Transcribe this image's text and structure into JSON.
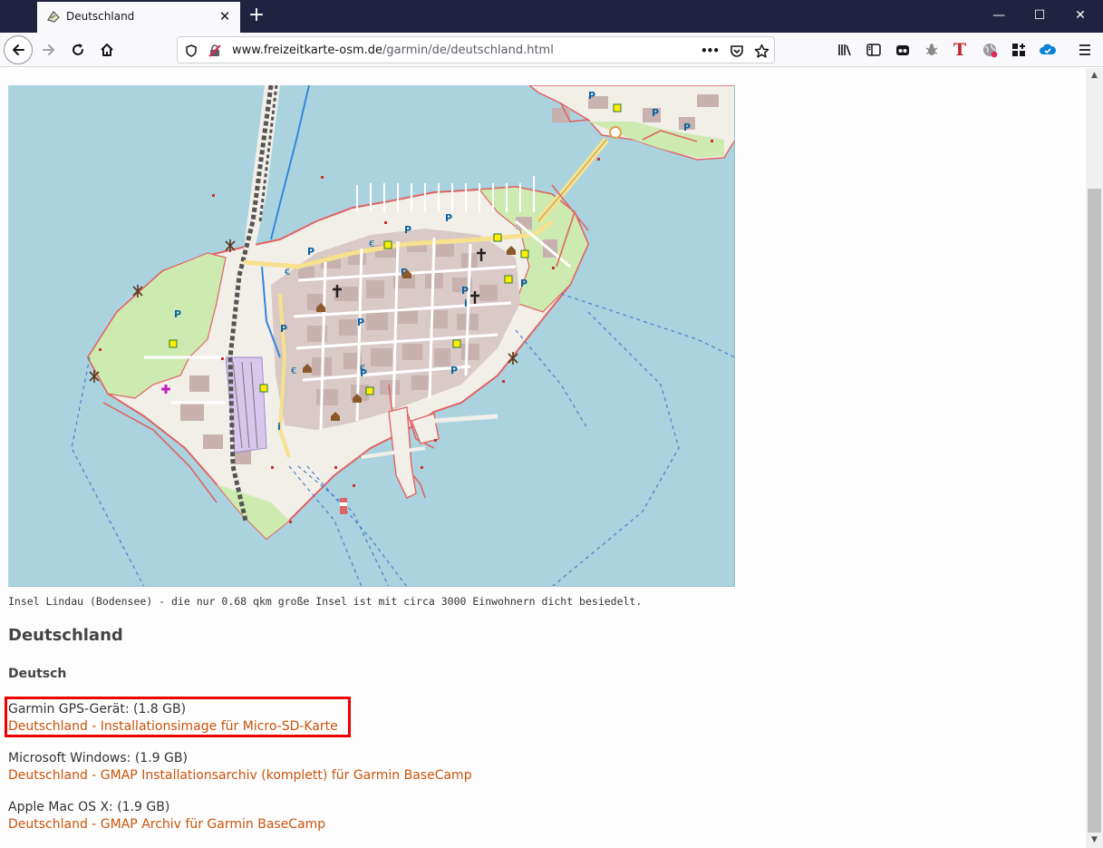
{
  "browser": {
    "tab_title": "Deutschland",
    "url_host": "www.freizeitkarte-osm.de",
    "url_path": "/garmin/de/deutschland.html",
    "page_actions_label": "•••"
  },
  "page": {
    "map_caption": "Insel Lindau (Bodensee) - die nur 0.68 qkm große Insel ist mit circa 3000 Einwohnern dicht besiedelt.",
    "heading": "Deutschland",
    "subheading": "Deutsch",
    "downloads": [
      {
        "label": "Garmin GPS-Gerät: (1.8 GB)",
        "link": "Deutschland - Installationsimage für Micro-SD-Karte"
      },
      {
        "label": "Microsoft Windows: (1.9 GB)",
        "link": "Deutschland - GMAP Installationsarchiv (komplett) für Garmin BaseCamp"
      },
      {
        "label": "Apple Mac OS X: (1.9 GB)",
        "link": "Deutschland - GMAP Archiv für Garmin BaseCamp"
      }
    ]
  },
  "colors": {
    "titlebar": "#202340",
    "link": "#c8530a",
    "highlight_box": "#ee0000",
    "map_water": "#aad3df",
    "map_land": "#f2efe9"
  },
  "icons": [
    "tab-favicon-icon",
    "close-icon",
    "plus-icon",
    "minimize-icon",
    "maximize-icon",
    "window-close-icon",
    "back-arrow-icon",
    "forward-arrow-icon",
    "reload-icon",
    "home-icon",
    "shield-icon",
    "insecure-lock-icon",
    "pocket-icon",
    "star-icon",
    "library-icon",
    "sidebar-icon",
    "extension-icons",
    "menu-icon"
  ]
}
